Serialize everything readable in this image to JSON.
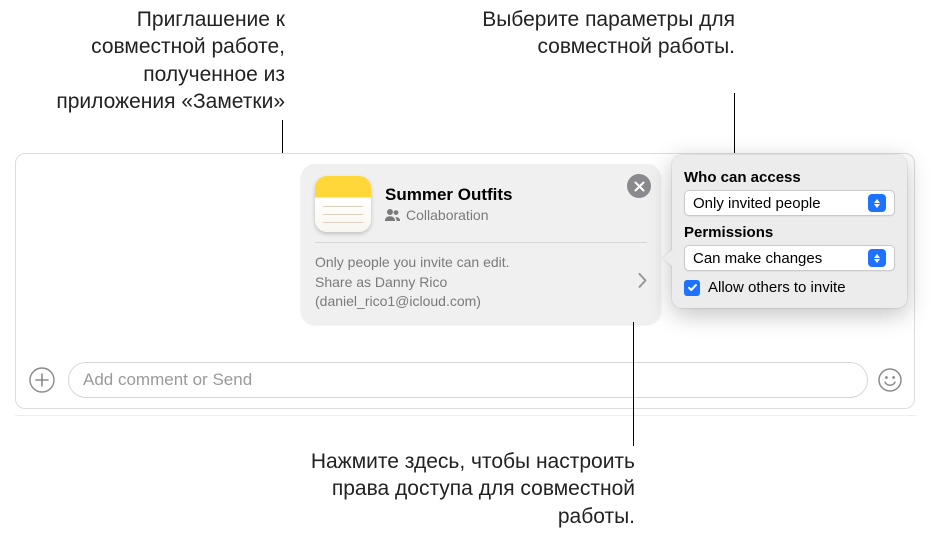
{
  "callouts": {
    "top_left": "Приглашение к совместной работе, полученное из приложения «Заметки»",
    "top_right": "Выберите параметры для совместной работы.",
    "bottom": "Нажмите здесь, чтобы настроить права доступа для совместной работы."
  },
  "card": {
    "title": "Summer Outfits",
    "subtitle": "Collaboration",
    "info_line": "Only people you invite can edit.",
    "share_as": "Share as Danny Rico",
    "email": "(daniel_rico1@icloud.com)"
  },
  "popover": {
    "access_label": "Who can access",
    "access_value": "Only invited people",
    "perm_label": "Permissions",
    "perm_value": "Can make changes",
    "allow_invite": "Allow others to invite"
  },
  "compose": {
    "placeholder": "Add comment or Send"
  }
}
